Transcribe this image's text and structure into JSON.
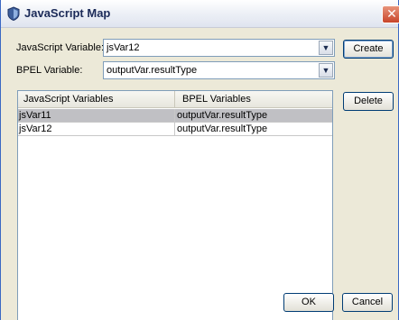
{
  "window": {
    "title": "JavaScript Map",
    "close_glyph": "✕"
  },
  "form": {
    "js_variable_label": "JavaScript Variable:",
    "js_variable_value": "jsVar12",
    "bpel_variable_label": "BPEL Variable:",
    "bpel_variable_value": "outputVar.resultType"
  },
  "buttons": {
    "create": "Create",
    "delete": "Delete",
    "ok": "OK",
    "cancel": "Cancel"
  },
  "table": {
    "columns": [
      "JavaScript Variables",
      "BPEL Variables"
    ],
    "rows": [
      {
        "js": "jsVar11",
        "bpel": "outputVar.resultType",
        "selected": true
      },
      {
        "js": "jsVar12",
        "bpel": "outputVar.resultType",
        "selected": false
      }
    ]
  },
  "icons": {
    "window": "netbeans-shield-icon",
    "dropdown": "chevron-down-icon",
    "close": "close-icon"
  }
}
